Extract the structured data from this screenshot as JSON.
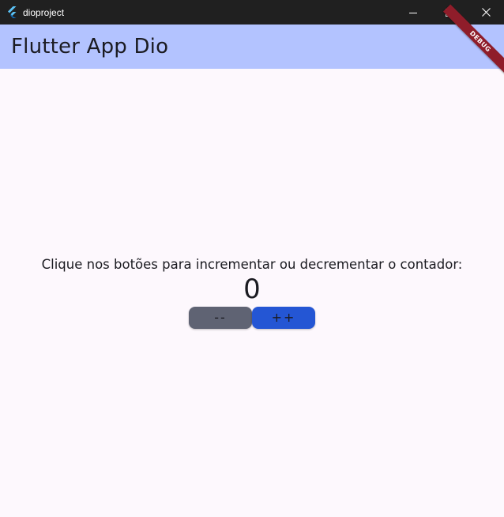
{
  "window": {
    "title": "dioproject",
    "app_icon": "flutter-logo-icon",
    "controls": [
      "minimize-icon",
      "maximize-icon",
      "close-icon"
    ]
  },
  "appbar": {
    "title": "Flutter App Dio",
    "background": "#b3c3ff"
  },
  "debug_banner": {
    "label": "DEBUG",
    "color": "#8f1d2a"
  },
  "main": {
    "prompt": "Clique nos botões para incrementar ou decrementar o contador:",
    "counter": "0",
    "decrement_label": "--",
    "increment_label": "++",
    "decrement_color": "#5f6373",
    "increment_color": "#2456d4"
  }
}
